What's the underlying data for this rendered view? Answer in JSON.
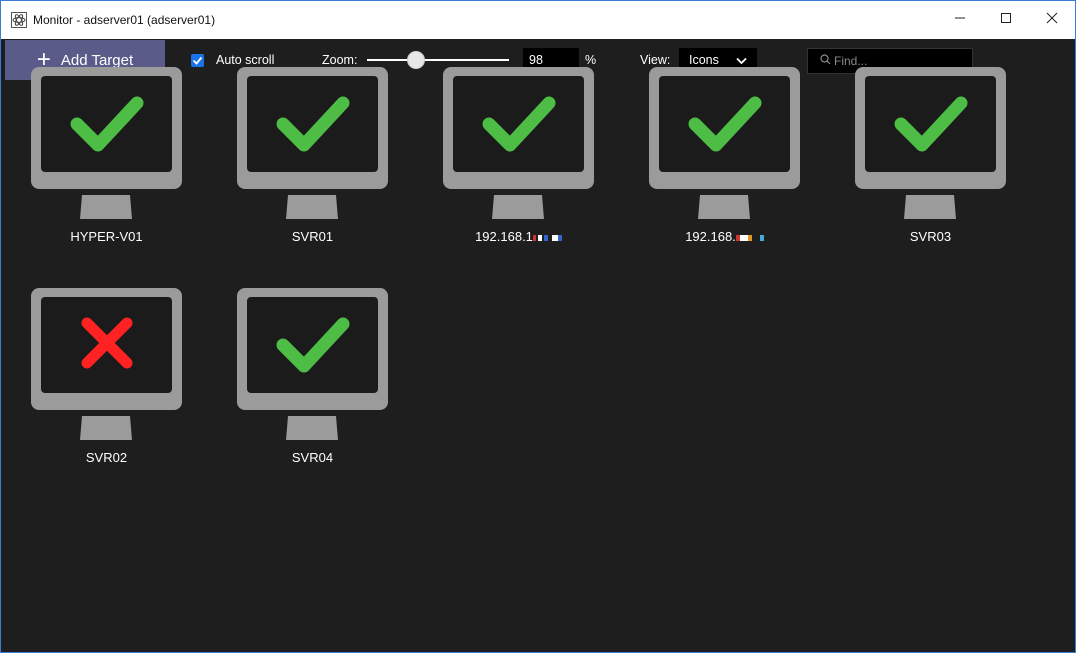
{
  "window": {
    "title": "Monitor - adserver01 (adserver01)",
    "controls": {
      "minimize": "–",
      "maximize": "☐",
      "close": "✕"
    }
  },
  "toolbar": {
    "add_target_label": "Add Target",
    "auto_scroll_label": "Auto scroll",
    "auto_scroll_checked": true,
    "zoom_label": "Zoom:",
    "zoom_value": "98",
    "zoom_unit": "%",
    "view_label": "View:",
    "view_value": "Icons",
    "find_placeholder": "Find..."
  },
  "colors": {
    "ok": "#4dbd46",
    "error": "#ff2222",
    "monitor": "#9b9b9b",
    "screen": "#1b1b1b",
    "accent": "#5b5b8a"
  },
  "targets": [
    {
      "name": "HYPER-V01",
      "status": "ok"
    },
    {
      "name": "SVR01",
      "status": "ok"
    },
    {
      "name": "192.168.1",
      "status": "ok"
    },
    {
      "name": "192.168.",
      "status": "ok"
    },
    {
      "name": "SVR03",
      "status": "ok"
    },
    {
      "name": "SVR02",
      "status": "error"
    },
    {
      "name": "SVR04",
      "status": "ok"
    }
  ]
}
